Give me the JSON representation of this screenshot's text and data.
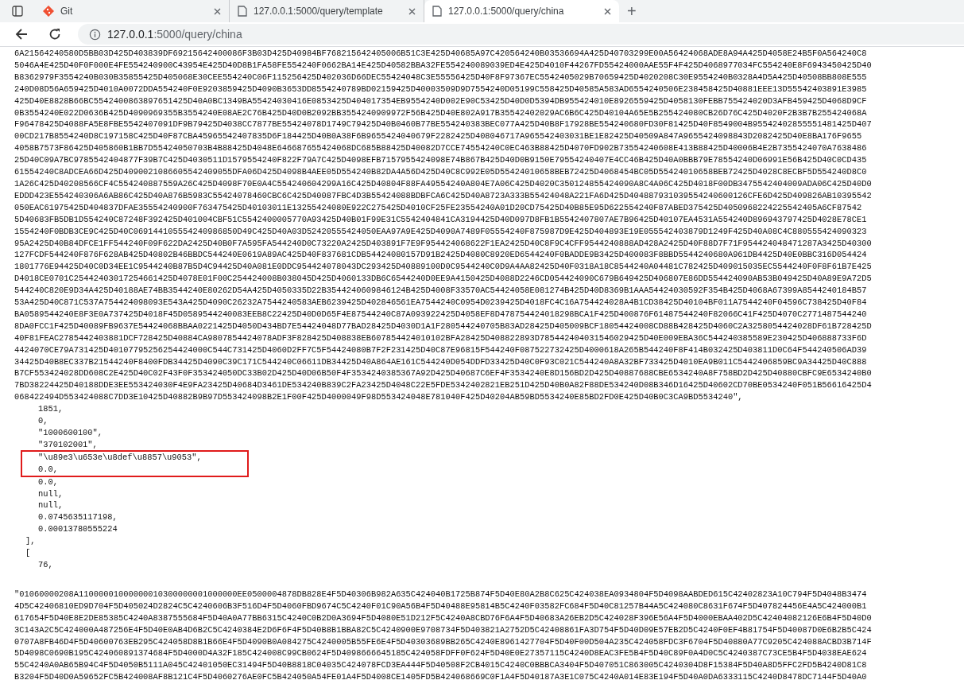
{
  "tabs": [
    {
      "kind": "git",
      "label": "Git",
      "selected": false
    },
    {
      "kind": "page",
      "label": "127.0.0.1:5000/query/template",
      "selected": false
    },
    {
      "kind": "page",
      "label": "127.0.0.1:5000/query/china",
      "selected": true
    }
  ],
  "new_tab": "+",
  "address_bar": {
    "host": "127.0.0.1",
    "path": ":5000/query/china"
  },
  "content": {
    "top_lines": [
      "6A21564240580D5BB03D425D403839DF69215642400086F3B03D425D40984BF768215642405006B51C3E425D40685A97C420564240B03536694A425D40703299E00A56424068ADE8A94A425D4058E24B5F0A564240C8",
      "5046A4E425D40F0F000E4FE554240900C43954E425D40D8B1FA58FE554240F0662BA14E425D40582BBA32FE554240089039ED4E425D4010F44267FD55424000AAE55F4F425D4068977034FC554240E8F6943450425D40",
      "B8362979F3554240B030B35855425D405068E30CEE554240C06F115256425D402036D66DEC55424048C3E55556425D40F8F97367EC5542405029B70659425D4020208C30E9554240B0328A4D5A425D40508BB808E555",
      "240D08D56A659425D4010A0072DDA554240F0E9203859425D4090B3653DD8554240789BD02159425D40003509D9D7554240D05199C558425D40585A583AD6554240506E238458425D40881EEE13D55542403891E3985",
      "425D40E8828B66BC5542400863897651425D40A0BC1349BA55424030416E0853425D404017354EB9554240D002E90C53425D40D0D5394DB955424010E8926559425D4058130FEBB755424020D3AFB459425D4068D9CF",
      "0B3554240E022D0636B425D4090969355B3554240E08AE2C76B425D40D0B2092BB3554240909972F56B425D40E802A917B35542402029AC6B6C425D40104A65E5B255424080CB26D76C425D4020F2B3B7B255424068A",
      "F96478425D4088FA5E8FBE5542407091DF9B79425D4038CC7877BE55424078D1749C79425D40B0460B77BE554240383BEC077A425D40B8F17928BE554240680FD30F81425D40F8549004B95542402855551481425D407",
      "00CD217B8554240D8C197158C425D40F87CBA45965542407835D6F184425D40B0A38F6B9655424040679F2282425D408046717A965542403031BE1E82425D40509A847A9655424098843D2082425D40E8BA176F9655",
      "4058B7573F86425D405860B1BB7D55424050703B4B88425D4048E646687655424068DC685B88425D40082D7CCE74554240C0EC463B88425D4070FD902B73554240608E413B88425D40006B4E2B7355424070A7638486",
      "25D40C09A7BC9785542404877F39B7C425D4030511D1579554240F822F79A7C425D4098EFB7157955424098E74B867B425D40D0B9150E79554240407E4CC46B425D40A0BBB79E78554240D06991E56B425D40C0CD435",
      "61554240C8ADCEA66D425D4090021086605542409055DFA06D425D4098B4AEE05D554240B82DA4A56D425D40C8C992E05D55424010658BEB72425D4068454BC05D55424010658BEB72425D4028C8ECBF5D554240D8C0",
      "1A26C425D40208566CF4C554240887559A26C425D4098F70E0A4C554240604299A16C425D40804F88FA49554240A804E7A06C425D4020C350124855424090A8C4A06C425D4018F00DB3475542404009ADA06C425D40D0",
      "EDDD423E554240306A6AB86C425D40A876B5983C55424078460CBC6C425D40087FBC4D3B55424088BDBFCA6C425D40A8723A333B55424048A221FA6D425D404887931039554240600126CFE6D425D409826AB10395542",
      "050EAC61975425D404837DFAE35554240900F763475425D40103011E13255424080E922C275425D4010CF25FE23554240A01D20CD75425D40B85E95D622554240F87ABED375425D4050968224225542405A6CF87542",
      "5D40683FB5DB1D554240C87248F392425D401004CBF51C5542400005770A93425D40B01F99E31C5542404841CA3194425D40D097D8FB1B5542407807AE7B96425D40107EA4531A554240D896943797425D4028E78CE1",
      "1554240F0BDB3CE9C425D40C069144105554240986850D49C425D40A03D52420555424050EAA97A9E425D4090A7489F05554240F875987D9E425D404893E19E055542403879D1249F425D40A08C4C880555424090323",
      "95A2425D40B84DFCE1FF544240F09F622DA2425D40B0F7A595FA544240D0C73220A2425D403891F7E9F954424068622F1EA2425D40C8F9C4CFF9544240888AD428A2425D40F88D7F71F954424048471287A3425D40300",
      "127FCDF544240F876F628AB425D40802B46BBDC544240E0619A89AC425D40F837681CDB54424080157D91B2425D4080C8920ED6544240F0BADDE9B3425D400083F8BBD5544240680A961DB4425D40E0BBC316D054424",
      "1801776E94425D40C0D34EE1C9544240B87B5D4C94425D40A081E0DDC954424078043DC293425D40889100D0C9544240C0D9A4AA82425D40F0318A18C8544240A04481C782425D409015035EC5544240F0F8F61B7E425",
      "D4018CE0701C25442403017254661425D4078E01F00C254424008B038045D425D4060133DB6C6544240D0EE9A4150425D4088D2246CD054424090C679B649425D406807E86DD554424090AB53B049425D40A89E9A72D5",
      "544240C820E9D34A425D40188AE74BB3544240E80262D54A425D4050335D22B3544240609846124B425D4008F33570AC54424058E081274B425D40D8369B1AAA54424030592F354B425D4068A67399A8544240184B57",
      "53A425D40C871C537A754424098093E543A425D4090C26232A7544240583AEB6239425D402846561EA7544240C0954D0239425D4018FC4C16A754424028A4B1CD38425D40104BF011A7544240F04596C738425D40F84",
      "BA0589544240E8F3E0A737425D4018F45D0589544240083EEB8C22425D40D0D65F4E87544240C87A093922425D4058EF8D478754424018298BCA1F425D400876F61487544240F82066C41F425D4070C2771487544240",
      "8DA0FCC1F425D40089FB9637E54424068BBAA0221425D4050D434BD7E54424048D77BAD28425D4030D1A1F280544240705B83AD28425D405009BCF18054424008CD88B428425D4060C2A3258054424028DF61B728425D",
      "40F81FEAC2785442403881DCF728425D40884CA9807854424078ADF3F828425D408838EB607854424010102BFA28425D408822893D785442404031546029425D40E009EBA36C544240385589E230425D406888733F6D",
      "4424070CE79A731425D40107795256254424000C544C731425D4060D2FF7C5F54424080B7F2F231425D40C87E96815F544240F087522732425D4000618A265B544240F8F414B032425D403811D0C64F544240506AD39",
      "34425D40B8EC337B21544240F8400FDB34425D4090C39C171C544240C06611DB34425D40A864AE161C544240D054DDFD33425D40C0F93C021C544240A8A32BF733425D4010EA9B011C5442406859BC9A34425D40C888",
      "B7CF553424028DD608C2E425D40C02F43F0F353424050DC33B02D425D40D06B50F4F3534240385367A92D425D40687C6EF4F3534240E8D156BD2D425D40887688CBE6534240A8F758BD2D425D40880CBFC9E6534240B0",
      "7BD38224425D40188DDE3EE553424030F4E9FA23425D40684D3461DE534240B839C2FA23425D4048C22E5FDE5342402821EB251D425D40B0A82F88DE534240D08B346D16425D40602CD70BE0534240F051B56616425D4",
      "068422494D553424088C7DD3E10425D40882B9B97D553424098B2E1F00F425D4000049F98D553424048E781040F425D40204AB59BD5534240E85BD2FD0E425D40B0C3CA9BD5534240\","
    ],
    "record_items": [
      {
        "text": "1851,",
        "highlighted": false
      },
      {
        "text": "0,",
        "highlighted": false
      },
      {
        "text": "\"1000600100\",",
        "highlighted": false
      },
      {
        "text": "\"370102001\",",
        "highlighted": false
      },
      {
        "text": "\"\\u89e3\\u653e\\u8def\\u8857\\u9053\",",
        "highlighted": true
      },
      {
        "text": "0.0,",
        "highlighted": true
      },
      {
        "text": "0.0,",
        "highlighted": false
      },
      {
        "text": "null,",
        "highlighted": false
      },
      {
        "text": "null,",
        "highlighted": false
      },
      {
        "text": "0.0745635117198,",
        "highlighted": false
      },
      {
        "text": "0.00013780555224",
        "highlighted": false
      }
    ],
    "record_close": "],",
    "next_open": "[",
    "next_items": [
      "76,"
    ],
    "bottom_lines": [
      "\"01060000208A11000001000000010300000001000000EE0500004878DB828E4F5D40306B982A635C424040B1725B874F5D40E80A2B8C625C424038EA0934804F5D4098AABDED615C42402823A10C794F5D4048B3474",
      "4D5C42406810ED9D704F5D405024D2824C5C4240606B3F516D4F5D4060FBD9674C5C4240F01C90A56B4F5D40488E95814B5C4240F03582FC684F5D40C81257B44A5C424080C8631F674F5D407824456E4A5C424000B1",
      "617654F5D40E8E2DE85385C4240A8387555684F5D40A0A77BB6315C4240C0B2D0A3694F5D4080E51D212F5C4240A8CBD76F6A4F5D40683A26EB2D5C424028F396E56A4F5D4000EBAA402D5C42404082126E6B4F5D40D0",
      "3C143A2C5C424000A487256E4F5D40E0AB4D6B2C5C4240384E2D6F6F4F5D40B8B1BBA82C5C4240900E9708734F5D403821A2752D5C42408861FA3D754F5D40D09E57EB2D5C4240F0EF4B81754F5D40087D0E6B2B5C424",
      "0707A8FB46D4F5D40600763EB295C424058D8B1B66E4F5D4090B0A084275C4240005B55FE6E4F5D40303689BB265C4240E8961427704F5D40F00D504A235C424058FDC3F6704F5D40880A77C9205C424088ACBD3B714F",
      "5D4098C0690B195C424060891374684F5D4000D4A32F185C424008C99CB0624F5D4098666645185C42405​8FDFF0F624F5D40E0E27357115C4240D8EAC3FE5B4F5D40C89F0A4D0C5C4240387C73CE5B4F5D4038EAE624",
      "55C4240A0AB65B94C4F5D4050B5111A045C42401050EC31494F5D40B8818C04035C424078FCD3EA444F5D40508F2CB4015C4240C0BBBCA3404F5D407051C863005C4240304D8F15384F5D40A8D5FFC2FD5B4240D81C8",
      "B3204F5D40D0A59652FC5B424008AF8B121C4F5D4060276AE0FC5B424050A54FE01A4F5D4008CE1405FD5B424068669C0F1A4F5D40187A3E1C075C4240A014E83E194F5D40A0DA6333115C4240D8478DC7144F5D40A0"
    ]
  }
}
